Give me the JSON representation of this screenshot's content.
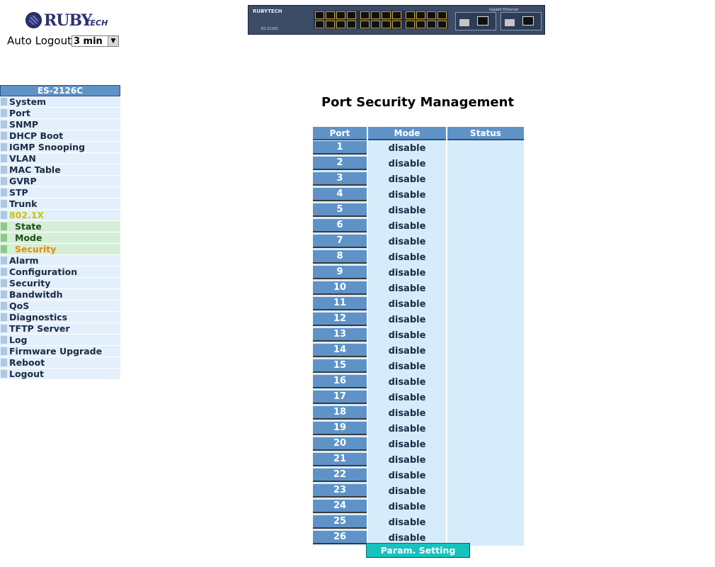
{
  "logo": {
    "name": "RUBY",
    "suffix": "TECH"
  },
  "auto_logout": {
    "label": "Auto Logout",
    "value": "3 min"
  },
  "switch_image": {
    "brand": "RUBYTECH",
    "model": "ES-2126C",
    "gigabit_label": "Gigabit Ethernet"
  },
  "sidebar": {
    "title": "ES-2126C",
    "items": [
      {
        "label": "System"
      },
      {
        "label": "Port"
      },
      {
        "label": "SNMP"
      },
      {
        "label": "DHCP Boot"
      },
      {
        "label": "IGMP Snooping"
      },
      {
        "label": "VLAN"
      },
      {
        "label": "MAC Table"
      },
      {
        "label": "GVRP"
      },
      {
        "label": "STP"
      },
      {
        "label": "Trunk"
      },
      {
        "label": "802.1X"
      },
      {
        "label": "State"
      },
      {
        "label": "Mode"
      },
      {
        "label": "Security"
      },
      {
        "label": "Alarm"
      },
      {
        "label": "Configuration"
      },
      {
        "label": "Security"
      },
      {
        "label": "Bandwitdh"
      },
      {
        "label": "QoS"
      },
      {
        "label": "Diagnostics"
      },
      {
        "label": "TFTP Server"
      },
      {
        "label": "Log"
      },
      {
        "label": "Firmware Upgrade"
      },
      {
        "label": "Reboot"
      },
      {
        "label": "Logout"
      }
    ]
  },
  "main": {
    "title": "Port Security Management",
    "table": {
      "headers": [
        "Port",
        "Mode",
        "Status"
      ],
      "rows": [
        {
          "port": "1",
          "mode": "disable",
          "status": ""
        },
        {
          "port": "2",
          "mode": "disable",
          "status": ""
        },
        {
          "port": "3",
          "mode": "disable",
          "status": ""
        },
        {
          "port": "4",
          "mode": "disable",
          "status": ""
        },
        {
          "port": "5",
          "mode": "disable",
          "status": ""
        },
        {
          "port": "6",
          "mode": "disable",
          "status": ""
        },
        {
          "port": "7",
          "mode": "disable",
          "status": ""
        },
        {
          "port": "8",
          "mode": "disable",
          "status": ""
        },
        {
          "port": "9",
          "mode": "disable",
          "status": ""
        },
        {
          "port": "10",
          "mode": "disable",
          "status": ""
        },
        {
          "port": "11",
          "mode": "disable",
          "status": ""
        },
        {
          "port": "12",
          "mode": "disable",
          "status": ""
        },
        {
          "port": "13",
          "mode": "disable",
          "status": ""
        },
        {
          "port": "14",
          "mode": "disable",
          "status": ""
        },
        {
          "port": "15",
          "mode": "disable",
          "status": ""
        },
        {
          "port": "16",
          "mode": "disable",
          "status": ""
        },
        {
          "port": "17",
          "mode": "disable",
          "status": ""
        },
        {
          "port": "18",
          "mode": "disable",
          "status": ""
        },
        {
          "port": "19",
          "mode": "disable",
          "status": ""
        },
        {
          "port": "20",
          "mode": "disable",
          "status": ""
        },
        {
          "port": "21",
          "mode": "disable",
          "status": ""
        },
        {
          "port": "22",
          "mode": "disable",
          "status": ""
        },
        {
          "port": "23",
          "mode": "disable",
          "status": ""
        },
        {
          "port": "24",
          "mode": "disable",
          "status": ""
        },
        {
          "port": "25",
          "mode": "disable",
          "status": ""
        },
        {
          "port": "26",
          "mode": "disable",
          "status": ""
        }
      ]
    },
    "button_label": "Param. Setting"
  },
  "colors": {
    "header_blue": "#5f93c8",
    "row_bg": "#d7ecfb",
    "button_teal": "#16c2be",
    "menu_active": "#e88a08",
    "menu_open": "#c9c400"
  }
}
